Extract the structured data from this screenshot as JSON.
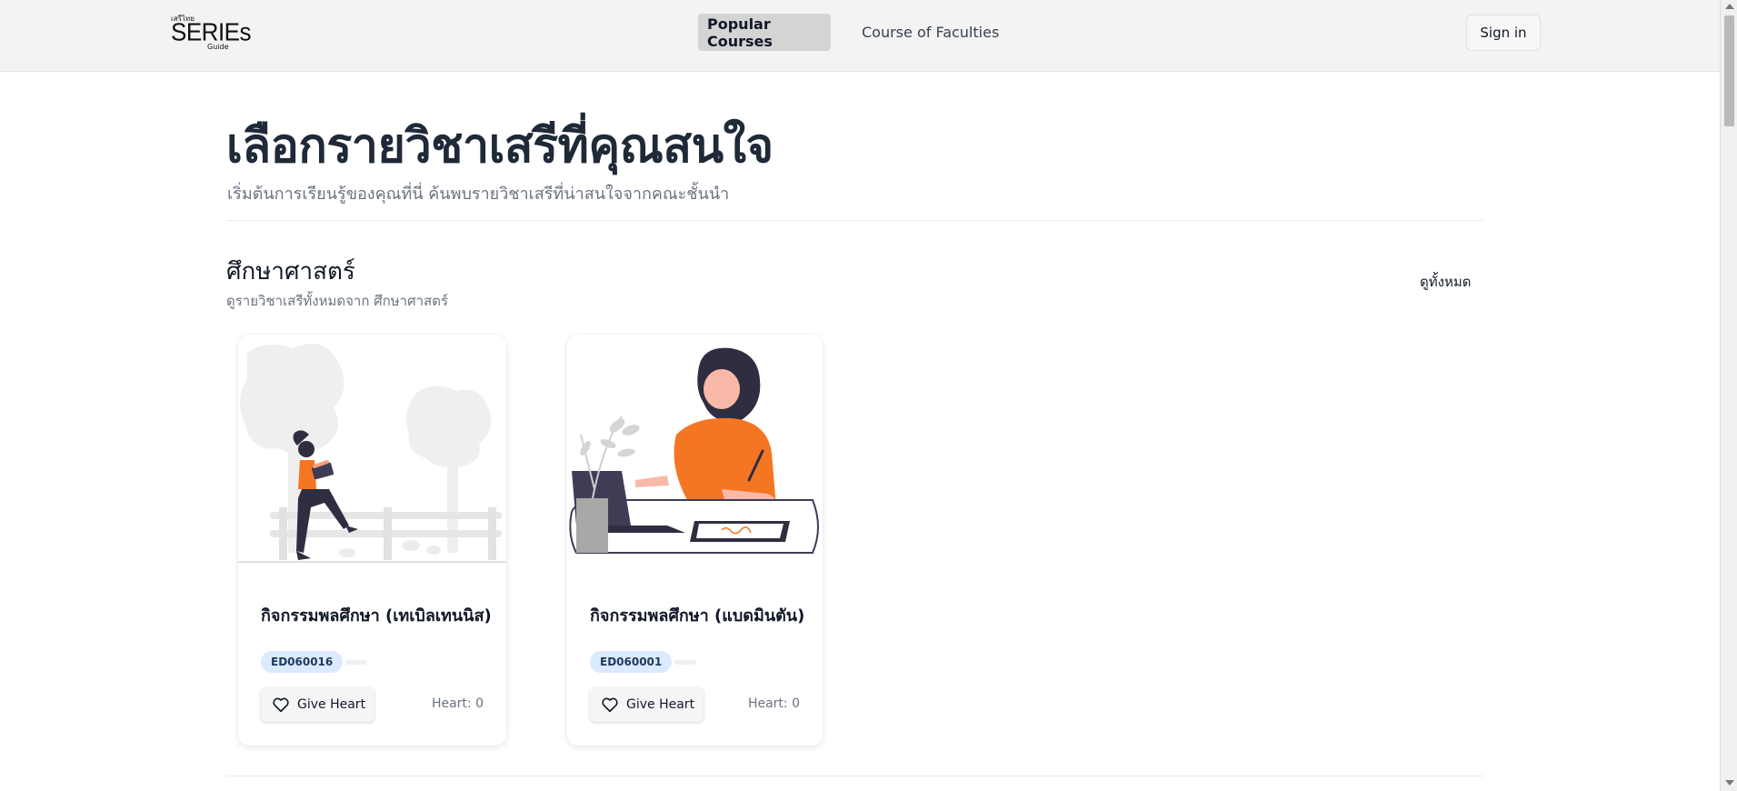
{
  "header": {
    "logo": {
      "top": "เสรีไทย",
      "main": "SERIEs",
      "sub": "Guide"
    },
    "tabs": [
      {
        "label": "Popular Courses",
        "active": true
      },
      {
        "label": "Course of Faculties",
        "active": false
      }
    ],
    "signin_label": "Sign in"
  },
  "hero": {
    "title": "เลือกรายวิชาเสรีที่คุณสนใจ",
    "subtitle": "เริ่มต้นการเรียนรู้ของคุณที่นี่ ค้นพบรายวิชาเสรีที่น่าสนใจจากคณะชั้นนำ"
  },
  "section": {
    "title": "ศึกษาศาสตร์",
    "subtitle": "ดูรายวิชาเสรีทั้งหมดจาก ศึกษาศาสตร์",
    "view_all": "ดูทั้งหมด"
  },
  "courses": [
    {
      "title": "กิจกรรมพลศึกษา (เทเบิลเทนนิส)",
      "code": "ED060016",
      "heart_button": "Give Heart",
      "heart_count": "Heart: 0",
      "image_icon": "person-sitting-on-fence-illustration"
    },
    {
      "title": "กิจกรรมพลศึกษา (แบดมินตัน)",
      "code": "ED060001",
      "heart_button": "Give Heart",
      "heart_count": "Heart: 0",
      "image_icon": "person-drawing-at-desk-illustration"
    }
  ],
  "colors": {
    "accent": "#f47623",
    "badge_bg": "#dbeafe",
    "header_bg": "#f3f3f3",
    "active_tab_bg": "#d4d4d4"
  }
}
